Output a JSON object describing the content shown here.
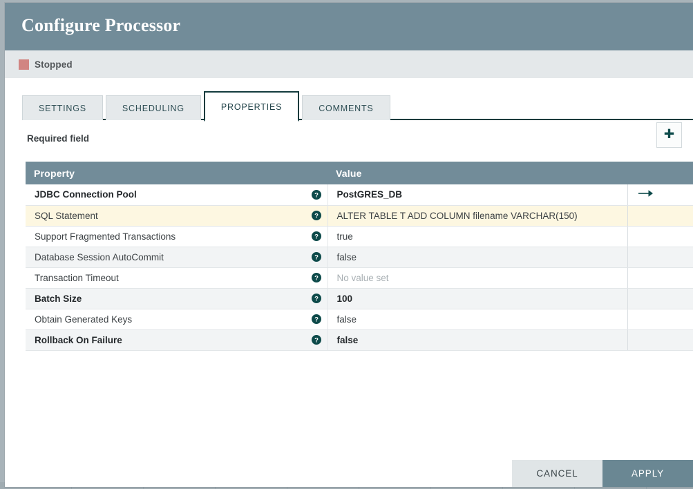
{
  "dialog": {
    "title": "Configure Processor",
    "status": {
      "label": "Stopped",
      "indicator_color": "#d18582"
    },
    "tabs": [
      {
        "label": "SETTINGS",
        "active": false
      },
      {
        "label": "SCHEDULING",
        "active": false
      },
      {
        "label": "PROPERTIES",
        "active": true
      },
      {
        "label": "COMMENTS",
        "active": false
      }
    ],
    "required_field_label": "Required field",
    "add_property_icon": "plus-icon",
    "table": {
      "columns": [
        "Property",
        "Value",
        ""
      ],
      "help_icon": "help-circle-icon",
      "goto_icon": "arrow-right-icon",
      "rows": [
        {
          "property": "JDBC Connection Pool",
          "value": "PostGRES_DB",
          "required": true,
          "selected": false,
          "value_set": true,
          "has_goto": true
        },
        {
          "property": "SQL Statement",
          "value": "ALTER TABLE T ADD COLUMN filename VARCHAR(150)",
          "required": false,
          "selected": true,
          "value_set": true,
          "has_goto": false
        },
        {
          "property": "Support Fragmented Transactions",
          "value": "true",
          "required": false,
          "selected": false,
          "value_set": true,
          "has_goto": false
        },
        {
          "property": "Database Session AutoCommit",
          "value": "false",
          "required": false,
          "selected": false,
          "value_set": true,
          "has_goto": false
        },
        {
          "property": "Transaction Timeout",
          "value": "No value set",
          "required": false,
          "selected": false,
          "value_set": false,
          "has_goto": false
        },
        {
          "property": "Batch Size",
          "value": "100",
          "required": true,
          "selected": false,
          "value_set": true,
          "has_goto": false
        },
        {
          "property": "Obtain Generated Keys",
          "value": "false",
          "required": false,
          "selected": false,
          "value_set": true,
          "has_goto": false
        },
        {
          "property": "Rollback On Failure",
          "value": "false",
          "required": true,
          "selected": false,
          "value_set": true,
          "has_goto": false
        }
      ]
    },
    "footer": {
      "cancel_label": "CANCEL",
      "apply_label": "APPLY"
    },
    "colors": {
      "header": "#728c99",
      "status_bar": "#e4e8ea",
      "accent_dark": "#123b3d",
      "selected_row": "#fdf7e1",
      "apply_button": "#6a8793"
    }
  }
}
